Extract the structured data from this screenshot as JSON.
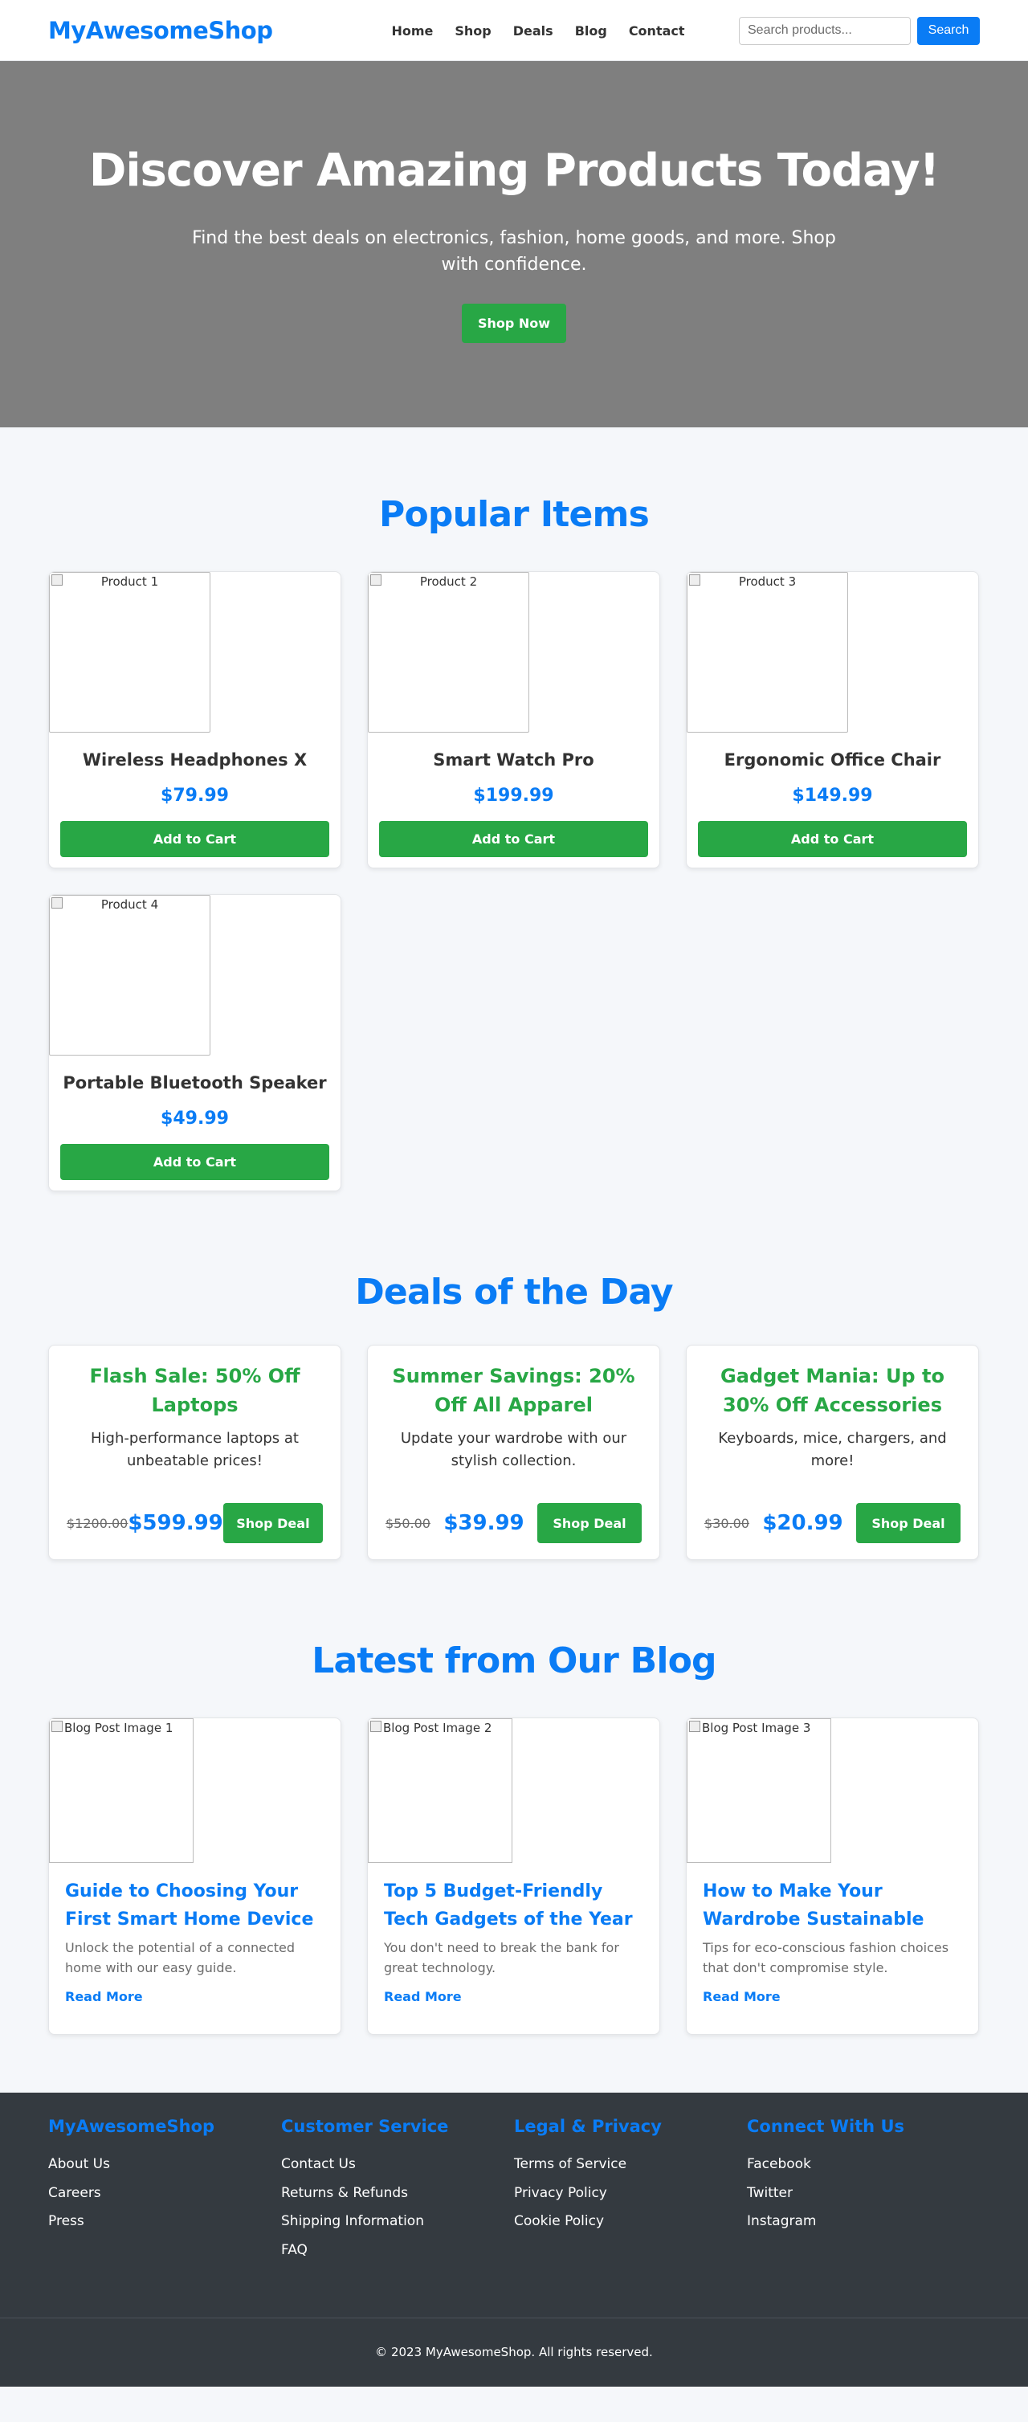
{
  "header": {
    "logo": "MyAwesomeShop",
    "nav": [
      "Home",
      "Shop",
      "Deals",
      "Blog",
      "Contact"
    ],
    "search_placeholder": "Search products...",
    "search_label": "Search"
  },
  "hero": {
    "title": "Discover Amazing Products Today!",
    "subtitle": "Find the best deals on electronics, fashion, home goods, and more. Shop with confidence.",
    "cta": "Shop Now",
    "bg_color": "#7f7f7f"
  },
  "popular": {
    "title": "Popular Items",
    "items": [
      {
        "image_alt": "Product 1",
        "name": "Wireless Headphones X",
        "price": "$79.99",
        "button": "Add to Cart"
      },
      {
        "image_alt": "Product 2",
        "name": "Smart Watch Pro",
        "price": "$199.99",
        "button": "Add to Cart"
      },
      {
        "image_alt": "Product 3",
        "name": "Ergonomic Office Chair",
        "price": "$149.99",
        "button": "Add to Cart"
      },
      {
        "image_alt": "Product 4",
        "name": "Portable Bluetooth Speaker",
        "price": "$49.99",
        "button": "Add to Cart"
      }
    ]
  },
  "deals": {
    "title": "Deals of the Day",
    "items": [
      {
        "title": "Flash Sale: 50% Off Laptops",
        "description": "High-performance laptops at unbeatable prices!",
        "old_price": "$1200.00",
        "new_price": "$599.99",
        "button": "Shop Deal"
      },
      {
        "title": "Summer Savings: 20% Off All Apparel",
        "description": "Update your wardrobe with our stylish collection.",
        "old_price": "$50.00",
        "new_price": "$39.99",
        "button": "Shop Deal"
      },
      {
        "title": "Gadget Mania: Up to 30% Off Accessories",
        "description": "Keyboards, mice, chargers, and more!",
        "old_price": "$30.00",
        "new_price": "$20.99",
        "button": "Shop Deal"
      }
    ]
  },
  "blog": {
    "title": "Latest from Our Blog",
    "posts": [
      {
        "image_alt": "Blog Post Image 1",
        "title": "Guide to Choosing Your First Smart Home Device",
        "excerpt": "Unlock the potential of a connected home with our easy guide.",
        "link": "Read More"
      },
      {
        "image_alt": "Blog Post Image 2",
        "title": "Top 5 Budget-Friendly Tech Gadgets of the Year",
        "excerpt": "You don't need to break the bank for great technology.",
        "link": "Read More"
      },
      {
        "image_alt": "Blog Post Image 3",
        "title": "How to Make Your Wardrobe Sustainable",
        "excerpt": "Tips for eco-conscious fashion choices that don't compromise style.",
        "link": "Read More"
      }
    ]
  },
  "footer": {
    "columns": [
      {
        "heading": "MyAwesomeShop",
        "links": [
          "About Us",
          "Careers",
          "Press"
        ]
      },
      {
        "heading": "Customer Service",
        "links": [
          "Contact Us",
          "Returns & Refunds",
          "Shipping Information",
          "FAQ"
        ]
      },
      {
        "heading": "Legal & Privacy",
        "links": [
          "Terms of Service",
          "Privacy Policy",
          "Cookie Policy"
        ]
      },
      {
        "heading": "Connect With Us",
        "links": [
          "Facebook",
          "Twitter",
          "Instagram"
        ]
      }
    ],
    "copyright": "© 2023 MyAwesomeShop. All rights reserved."
  },
  "colors": {
    "primary": "#0a7cf5",
    "success": "#28a745",
    "footer_bg": "#343a40",
    "page_bg": "#f5f7fa"
  }
}
